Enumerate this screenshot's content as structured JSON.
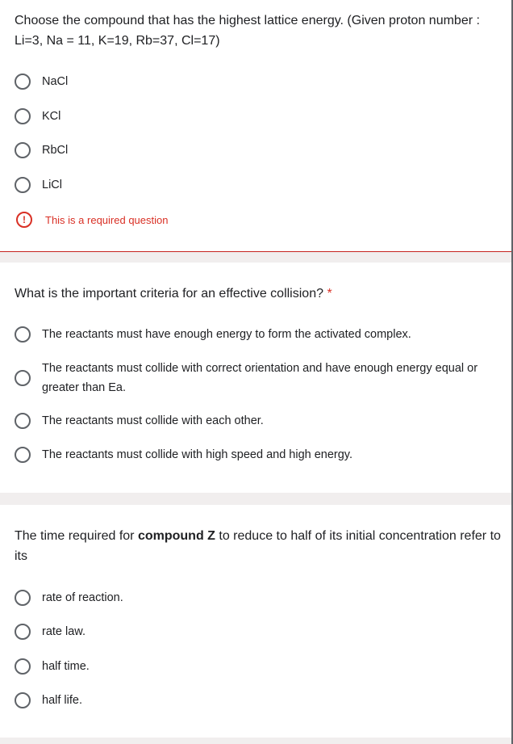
{
  "questions": [
    {
      "title": "Choose the compound that has the highest lattice energy. (Given proton number : Li=3, Na = 11, K=19, Rb=37, Cl=17)",
      "required_marker": "",
      "options": [
        "NaCl",
        "KCl",
        "RbCl",
        "LiCl"
      ],
      "error_text": "This is a required question"
    },
    {
      "title": "What is the important criteria for an effective collision?",
      "required_marker": "*",
      "options": [
        "The reactants must have enough energy to form the activated complex.",
        "The reactants must collide with correct orientation and have enough energy equal or greater than Ea.",
        "The reactants must collide with each other.",
        "The reactants must collide with high speed and high energy."
      ]
    },
    {
      "title_pre": "The time required for ",
      "title_bold": "compound Z",
      "title_post": " to reduce to half of its initial concentration refer to its",
      "options": [
        "rate of reaction.",
        "rate law.",
        "half time.",
        "half life."
      ]
    }
  ],
  "colors": {
    "error": "#d93025",
    "radio": "#5f6368",
    "section_gap": "#f1eeee"
  }
}
